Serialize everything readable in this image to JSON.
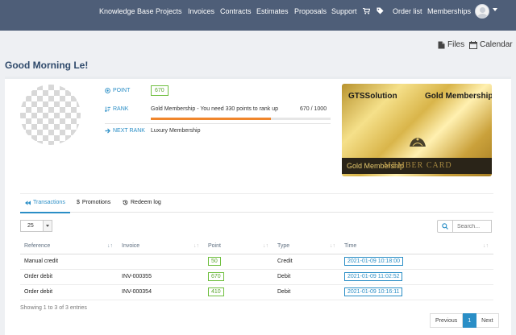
{
  "nav": {
    "items": [
      "Knowledge Base",
      "Projects",
      "Invoices",
      "Contracts",
      "Estimates",
      "Proposals",
      "Support"
    ],
    "order_list": "Order list",
    "memberships": "Memberships"
  },
  "header": {
    "files_label": "Files",
    "calendar_label": "Calendar",
    "greeting": "Good Morning Le!"
  },
  "stats": {
    "point_label": "POINT",
    "point_value": "670",
    "rank_label": "RANK",
    "rank_text": "Gold Membership - You need 330 points to rank up",
    "rank_count": "670 / 1000",
    "rank_progress": 0.67,
    "next_rank_label": "NEXT RANK",
    "next_rank_value": "Luxury Membership"
  },
  "card": {
    "company": "GTSSolution",
    "tier": "Gold Membership",
    "band_text": "Gold Membership",
    "subtitle": "MEMBER CARD"
  },
  "tabs": [
    "Transactions",
    "Promotions",
    "Redeem log"
  ],
  "controls": {
    "page_size": "25",
    "search_placeholder": "Search..."
  },
  "table": {
    "headers": [
      "Reference",
      "Invoice",
      "Point",
      "Type",
      "Time"
    ],
    "rows": [
      {
        "reference": "Manual credit",
        "invoice": "",
        "point": "50",
        "type": "Credit",
        "time": "2021-01-09 10:18:00"
      },
      {
        "reference": "Order debit",
        "invoice": "INV-000355",
        "point": "670",
        "type": "Debit",
        "time": "2021-01-09 11:02:52"
      },
      {
        "reference": "Order debit",
        "invoice": "INV-000354",
        "point": "410",
        "type": "Debit",
        "time": "2021-01-09 10:16:11"
      }
    ]
  },
  "footer": {
    "showing": "Showing 1 to 3 of 3 entries",
    "previous": "Previous",
    "page": "1",
    "next": "Next"
  },
  "colors": {
    "nav_bg": "#4e5e78",
    "accent": "#2a8ec6",
    "point_green": "#5aa52e",
    "progress": "#f0862c"
  }
}
